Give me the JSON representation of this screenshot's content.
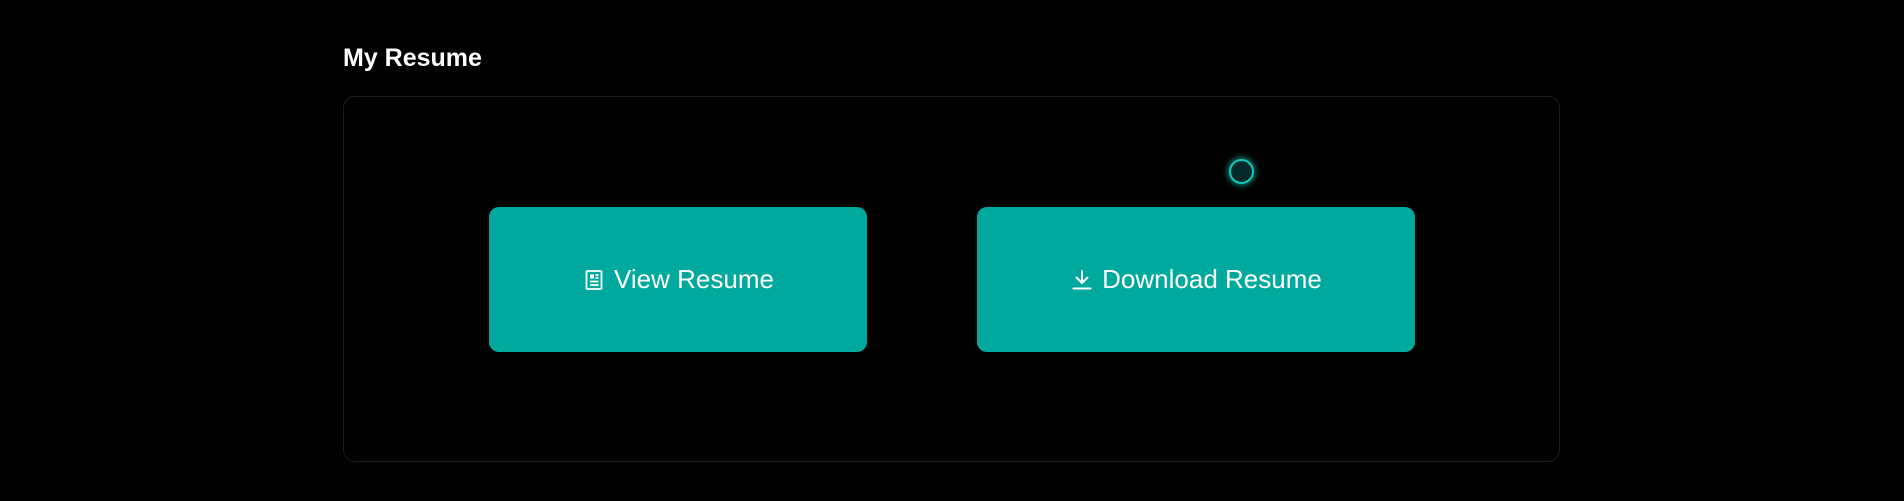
{
  "section": {
    "title": "My Resume"
  },
  "buttons": {
    "view": {
      "label": "View Resume",
      "icon": "document-icon"
    },
    "download": {
      "label": "Download Resume",
      "icon": "download-icon"
    }
  },
  "colors": {
    "background": "#000000",
    "accent": "#00a99e",
    "card_border": "#1c1c1c",
    "text": "#ffffff",
    "cursor_ring": "#16c7b8"
  }
}
